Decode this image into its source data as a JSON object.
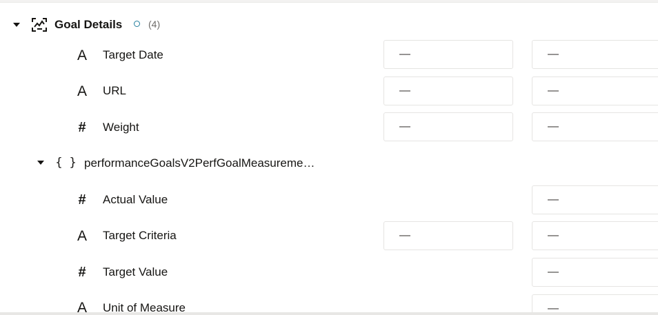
{
  "section": {
    "title": "Goal Details",
    "count": "(4)",
    "status_color": "#227e9e",
    "icon": "goal-details-icon",
    "fields": [
      {
        "type_glyph": "A",
        "type": "text",
        "label": "Target Date",
        "col1": "—",
        "col2": "—"
      },
      {
        "type_glyph": "A",
        "type": "text",
        "label": "URL",
        "col1": "—",
        "col2": "—"
      },
      {
        "type_glyph": "#",
        "type": "number",
        "label": "Weight",
        "col1": "—",
        "col2": "—"
      }
    ]
  },
  "group": {
    "braces": "{ }",
    "label": "performanceGoalsV2PerfGoalMeasureme…",
    "fields": [
      {
        "type_glyph": "#",
        "type": "number",
        "label": "Actual Value",
        "col2": "—"
      },
      {
        "type_glyph": "A",
        "type": "text",
        "label": "Target Criteria",
        "col1": "—",
        "col2": "—"
      },
      {
        "type_glyph": "#",
        "type": "number",
        "label": "Target Value",
        "col2": "—"
      },
      {
        "type_glyph": "A",
        "type": "text",
        "label": "Unit of Measure",
        "col2": "—"
      }
    ]
  }
}
